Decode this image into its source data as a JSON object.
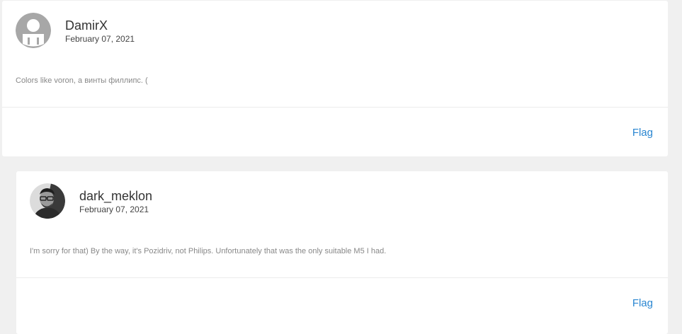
{
  "comments": [
    {
      "username": "DamirX",
      "date": "February 07, 2021",
      "text": "Colors like voron, а винты филлипс. (",
      "flag_label": "Flag",
      "avatar_icon": "default-user-icon"
    },
    {
      "username": "dark_meklon",
      "date": "February 07, 2021",
      "text": "I'm sorry for that) By the way, it's Pozidriv, not Philips. Unfortunately that was the only suitable M5 I had.",
      "flag_label": "Flag",
      "avatar_icon": "user-photo"
    }
  ],
  "colors": {
    "page_background": "#f0f0f0",
    "card_background": "#ffffff",
    "link": "#2a86d1"
  }
}
